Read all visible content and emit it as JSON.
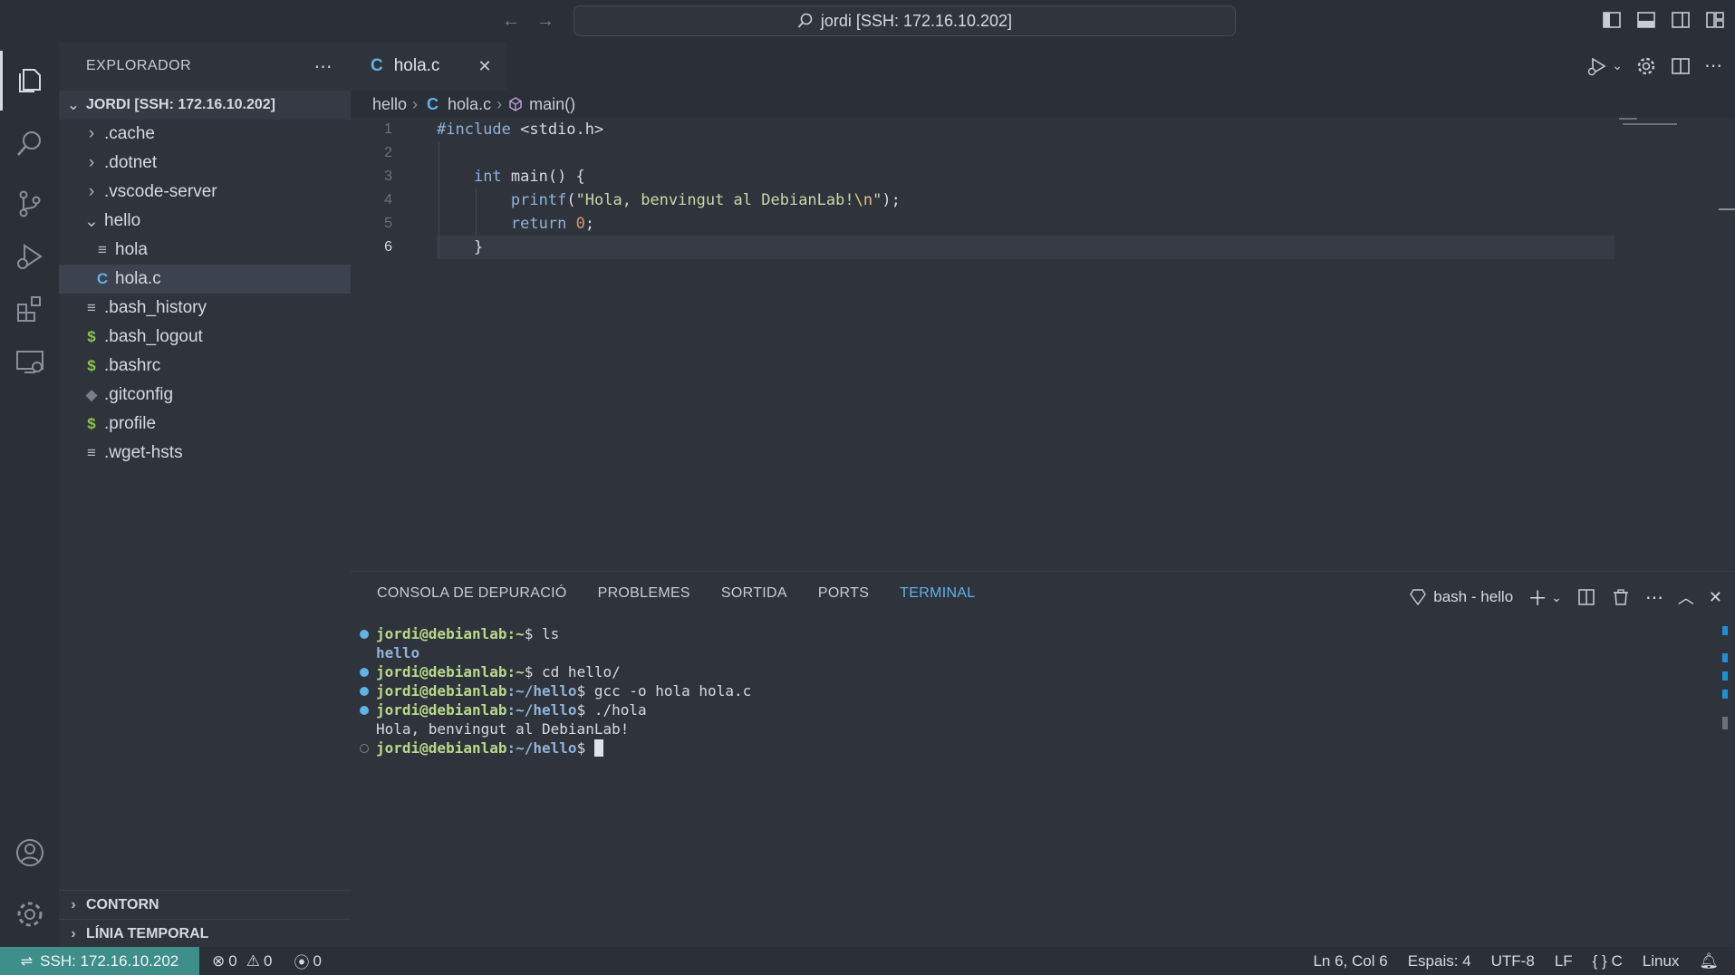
{
  "titlebar": {
    "search_text": "jordi [SSH: 172.16.10.202]"
  },
  "sidebar": {
    "title": "EXPLORADOR",
    "root_label": "JORDI [SSH: 172.16.10.202]",
    "items": [
      {
        "label": ".cache",
        "type": "folder"
      },
      {
        "label": ".dotnet",
        "type": "folder"
      },
      {
        "label": ".vscode-server",
        "type": "folder"
      },
      {
        "label": "hello",
        "type": "folder-open"
      },
      {
        "label": "hola",
        "type": "file"
      },
      {
        "label": "hola.c",
        "type": "c-file"
      },
      {
        "label": ".bash_history",
        "type": "file"
      },
      {
        "label": ".bash_logout",
        "type": "shell"
      },
      {
        "label": ".bashrc",
        "type": "shell"
      },
      {
        "label": ".gitconfig",
        "type": "git"
      },
      {
        "label": ".profile",
        "type": "shell"
      },
      {
        "label": ".wget-hsts",
        "type": "file"
      }
    ],
    "sections": {
      "outline": "CONTORN",
      "timeline": "LÍNIA TEMPORAL"
    }
  },
  "editor": {
    "tab_label": "hola.c",
    "tab_icon": "C",
    "breadcrumb": {
      "folder": "hello",
      "file": "hola.c",
      "symbol": "main()"
    },
    "line_numbers": [
      "1",
      "2",
      "3",
      "4",
      "5",
      "6"
    ],
    "code": {
      "l1_directive": "#include",
      "l1_header": " <stdio.h>",
      "l3_type": "int",
      "l3_rest": " main() {",
      "l4_fn": "printf",
      "l4_open": "(",
      "l4_str": "\"Hola, benvingut al DebianLab!",
      "l4_esc": "\\n",
      "l4_strend": "\"",
      "l4_close": ");",
      "l5_kw": "return",
      "l5_num": "0",
      "l5_semi": ";",
      "l6_brace": "}"
    }
  },
  "panel": {
    "tabs": [
      "CONSOLA DE DEPURACIÓ",
      "PROBLEMES",
      "SORTIDA",
      "PORTS",
      "TERMINAL"
    ],
    "active_tab": "TERMINAL",
    "terminal_name": "bash - hello",
    "terminal": {
      "prompt_user": "jordi@debianlab",
      "home": ":~",
      "hello_path": ":~/hello",
      "cmd1": "$ ls",
      "out1": "hello",
      "cmd2": "$ cd hello/",
      "cmd3": "$ gcc -o hola hola.c",
      "cmd4": "$ ./hola",
      "out4": "Hola, benvingut al DebianLab!",
      "last_prompt_sign": "$ "
    }
  },
  "statusbar": {
    "remote": "SSH: 172.16.10.202",
    "errors": "0",
    "warnings": "0",
    "ports": "0",
    "position": "Ln 6, Col 6",
    "indent": "Espais: 4",
    "encoding": "UTF-8",
    "eol": "LF",
    "language": "C",
    "os": "Linux"
  },
  "colors": {
    "accent": "#5fb3e6",
    "remote_bg": "#3e8e8a",
    "c_icon": "#5fb3e6",
    "shell_icon": "#8bc34a"
  }
}
